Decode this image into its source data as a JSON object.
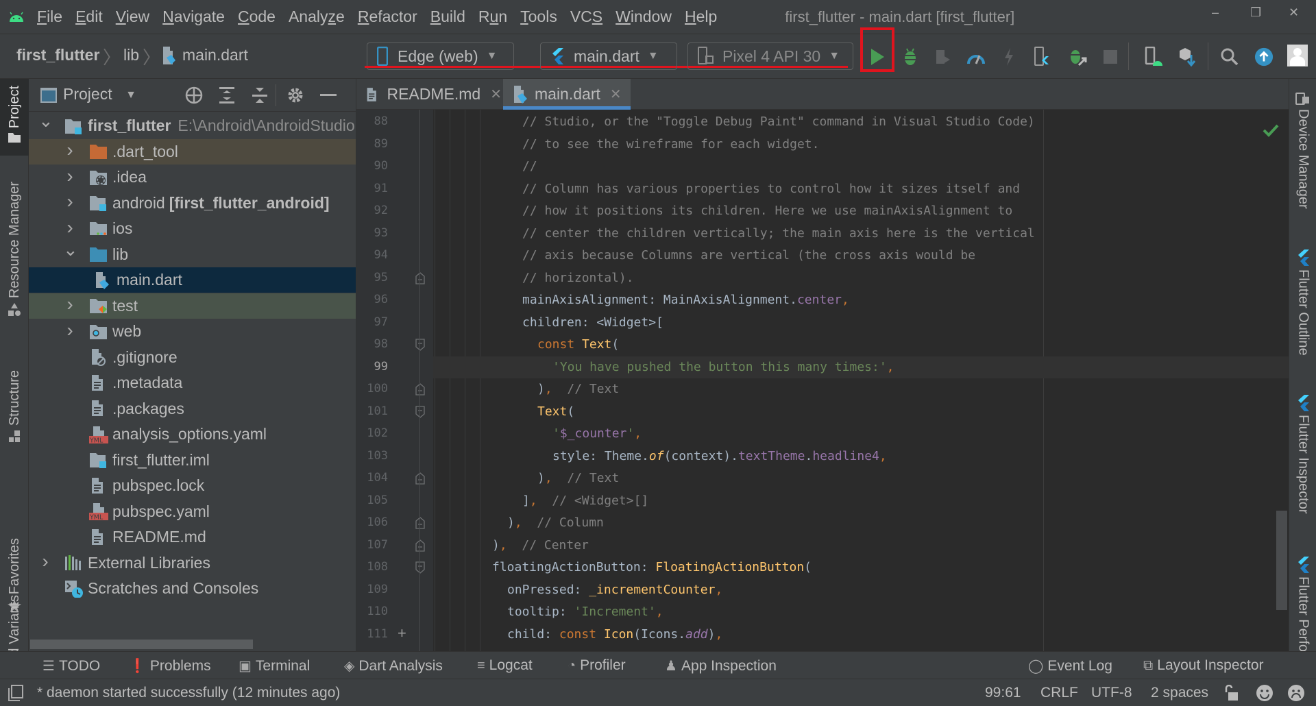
{
  "menubar": {
    "items": [
      {
        "label": "File",
        "mnemonic": 0
      },
      {
        "label": "Edit",
        "mnemonic": 0
      },
      {
        "label": "View",
        "mnemonic": 0
      },
      {
        "label": "Navigate",
        "mnemonic": 0
      },
      {
        "label": "Code",
        "mnemonic": 0
      },
      {
        "label": "Analyze",
        "mnemonic": 5
      },
      {
        "label": "Refactor",
        "mnemonic": 0
      },
      {
        "label": "Build",
        "mnemonic": 0
      },
      {
        "label": "Run",
        "mnemonic": 1
      },
      {
        "label": "Tools",
        "mnemonic": 0
      },
      {
        "label": "VCS",
        "mnemonic": 2
      },
      {
        "label": "Window",
        "mnemonic": 0
      },
      {
        "label": "Help",
        "mnemonic": 0
      }
    ],
    "window_title": "first_flutter - main.dart [first_flutter]",
    "minimize": "–",
    "restore": "❐",
    "close": "✕"
  },
  "navbar": {
    "breadcrumb": [
      "first_flutter",
      "lib",
      "main.dart"
    ],
    "device_combo": "Edge (web)",
    "config_combo": "main.dart",
    "emulator_combo": "Pixel 4 API 30"
  },
  "toolbar_icons": [
    "run-icon",
    "debug-icon",
    "run-with-coverage-icon",
    "profile-icon",
    "hot-reload-icon",
    "flutter-attach-icon",
    "attach-debugger-icon",
    "stop-icon",
    "device-manager-icon",
    "sdk-manager-icon",
    "search-icon",
    "update-icon",
    "account-icon"
  ],
  "left_strip": {
    "tabs": [
      "Project",
      "Resource Manager",
      "Structure",
      "Favorites",
      "Build Variants"
    ]
  },
  "project_panel": {
    "title": "Project",
    "tree": [
      {
        "label": "first_flutter",
        "path": "E:\\Android\\AndroidStudio",
        "bold": true,
        "expanded": true,
        "level": 0,
        "icon": "module-folder"
      },
      {
        "label": ".dart_tool",
        "level": 1,
        "expandable": true,
        "icon": "excluded-folder",
        "state": "ignored"
      },
      {
        "label": ".idea",
        "level": 1,
        "expandable": true,
        "icon": "idea-folder"
      },
      {
        "label": "android",
        "suffix": "[first_flutter_android]",
        "level": 1,
        "expandable": true,
        "icon": "module-folder"
      },
      {
        "label": "ios",
        "level": 1,
        "expandable": true,
        "icon": "ios-folder"
      },
      {
        "label": "lib",
        "level": 1,
        "expandable": true,
        "expanded": true,
        "icon": "source-folder"
      },
      {
        "label": "main.dart",
        "level": 2,
        "icon": "dart-file",
        "state": "selected"
      },
      {
        "label": "test",
        "level": 1,
        "expandable": true,
        "icon": "test-folder",
        "state": "test"
      },
      {
        "label": "web",
        "level": 1,
        "expandable": true,
        "icon": "web-folder"
      },
      {
        "label": ".gitignore",
        "level": 1,
        "icon": "ignore-file"
      },
      {
        "label": ".metadata",
        "level": 1,
        "icon": "text-file"
      },
      {
        "label": ".packages",
        "level": 1,
        "icon": "text-file"
      },
      {
        "label": "analysis_options.yaml",
        "level": 1,
        "icon": "yaml-file"
      },
      {
        "label": "first_flutter.iml",
        "level": 1,
        "icon": "module-file"
      },
      {
        "label": "pubspec.lock",
        "level": 1,
        "icon": "text-file"
      },
      {
        "label": "pubspec.yaml",
        "level": 1,
        "icon": "yaml-file"
      },
      {
        "label": "README.md",
        "level": 1,
        "icon": "text-file"
      },
      {
        "label": "External Libraries",
        "level": 0,
        "expandable": true,
        "icon": "libraries"
      },
      {
        "label": "Scratches and Consoles",
        "level": 0,
        "icon": "scratches"
      }
    ]
  },
  "editor": {
    "tabs": [
      {
        "label": "README.md",
        "active": false
      },
      {
        "label": "main.dart",
        "active": true
      }
    ],
    "current_line": 99,
    "lines": [
      {
        "n": 88,
        "indent": 2,
        "tokens": [
          [
            "c-com",
            "// Studio, or the \"Toggle Debug Paint\" command in Visual Studio Code)"
          ]
        ]
      },
      {
        "n": 89,
        "indent": 2,
        "tokens": [
          [
            "c-com",
            "// to see the wireframe for each widget."
          ]
        ]
      },
      {
        "n": 90,
        "indent": 2,
        "tokens": [
          [
            "c-com",
            "//"
          ]
        ]
      },
      {
        "n": 91,
        "indent": 2,
        "tokens": [
          [
            "c-com",
            "// Column has various properties to control how it sizes itself and"
          ]
        ]
      },
      {
        "n": 92,
        "indent": 2,
        "tokens": [
          [
            "c-com",
            "// how it positions its children. Here we use mainAxisAlignment to"
          ]
        ]
      },
      {
        "n": 93,
        "indent": 2,
        "tokens": [
          [
            "c-com",
            "// center the children vertically; the main axis here is the vertical"
          ]
        ]
      },
      {
        "n": 94,
        "indent": 2,
        "tokens": [
          [
            "c-com",
            "// axis because Columns are vertical (the cross axis would be"
          ]
        ]
      },
      {
        "n": 95,
        "indent": 2,
        "fold": "end",
        "tokens": [
          [
            "c-com",
            "// horizontal)."
          ]
        ]
      },
      {
        "n": 96,
        "indent": 2,
        "tokens": [
          [
            "c-plain",
            "mainAxisAlignment: MainAxisAlignment."
          ],
          [
            "c-fld",
            "center"
          ],
          [
            "c-punc",
            ","
          ]
        ]
      },
      {
        "n": 97,
        "indent": 2,
        "tokens": [
          [
            "c-plain",
            "children: <Widget>["
          ]
        ]
      },
      {
        "n": 98,
        "indent": 3,
        "fold": "start",
        "tokens": [
          [
            "c-kw",
            "const "
          ],
          [
            "c-cls",
            "Text"
          ],
          [
            "c-plain",
            "("
          ]
        ]
      },
      {
        "n": 99,
        "indent": 4,
        "tokens": [
          [
            "c-str",
            "'You have pushed the button this many times:'"
          ],
          [
            "c-punc",
            ","
          ]
        ]
      },
      {
        "n": 100,
        "indent": 3,
        "fold": "end",
        "tokens": [
          [
            "c-plain",
            ")"
          ],
          [
            "c-punc",
            ","
          ],
          [
            "c-com",
            "  // Text"
          ]
        ]
      },
      {
        "n": 101,
        "indent": 3,
        "fold": "start",
        "tokens": [
          [
            "c-cls",
            "Text"
          ],
          [
            "c-plain",
            "("
          ]
        ]
      },
      {
        "n": 102,
        "indent": 4,
        "tokens": [
          [
            "c-str",
            "'"
          ],
          [
            "c-fld",
            "$_counter"
          ],
          [
            "c-str",
            "'"
          ],
          [
            "c-punc",
            ","
          ]
        ]
      },
      {
        "n": 103,
        "indent": 4,
        "tokens": [
          [
            "c-plain",
            "style: Theme."
          ],
          [
            "c-fn",
            "of"
          ],
          [
            "c-plain",
            "(context)."
          ],
          [
            "c-fld",
            "textTheme"
          ],
          [
            "c-plain",
            "."
          ],
          [
            "c-fld",
            "headline4"
          ],
          [
            "c-punc",
            ","
          ]
        ]
      },
      {
        "n": 104,
        "indent": 3,
        "fold": "end",
        "tokens": [
          [
            "c-plain",
            ")"
          ],
          [
            "c-punc",
            ","
          ],
          [
            "c-com",
            "  // Text"
          ]
        ]
      },
      {
        "n": 105,
        "indent": 2,
        "tokens": [
          [
            "c-plain",
            "]"
          ],
          [
            "c-punc",
            ","
          ],
          [
            "c-com",
            "  // <Widget>[]"
          ]
        ]
      },
      {
        "n": 106,
        "indent": 1,
        "fold": "end",
        "tokens": [
          [
            "c-plain",
            ")"
          ],
          [
            "c-punc",
            ","
          ],
          [
            "c-com",
            "  // Column"
          ]
        ]
      },
      {
        "n": 107,
        "indent": 0,
        "fold": "end",
        "tokens": [
          [
            "c-plain",
            ")"
          ],
          [
            "c-punc",
            ","
          ],
          [
            "c-com",
            "  // Center"
          ]
        ]
      },
      {
        "n": 108,
        "indent": 0,
        "fold": "start",
        "tokens": [
          [
            "c-plain",
            "floatingActionButton: "
          ],
          [
            "c-cls",
            "FloatingActionButton"
          ],
          [
            "c-plain",
            "("
          ]
        ]
      },
      {
        "n": 109,
        "indent": 1,
        "tokens": [
          [
            "c-plain",
            "onPressed: "
          ],
          [
            "c-cls",
            "_incrementCounter"
          ],
          [
            "c-punc",
            ","
          ]
        ]
      },
      {
        "n": 110,
        "indent": 1,
        "tokens": [
          [
            "c-plain",
            "tooltip: "
          ],
          [
            "c-str",
            "'Increment'"
          ],
          [
            "c-punc",
            ","
          ]
        ]
      },
      {
        "n": 111,
        "indent": 1,
        "marker": "+",
        "tokens": [
          [
            "c-plain",
            "child: "
          ],
          [
            "c-kw",
            "const "
          ],
          [
            "c-cls",
            "Icon"
          ],
          [
            "c-plain",
            "(Icons."
          ],
          [
            "c-itl",
            "add"
          ],
          [
            "c-plain",
            ")"
          ],
          [
            "c-punc",
            ","
          ]
        ]
      }
    ],
    "inspection_status": "no-problems"
  },
  "right_strip": {
    "tabs": [
      "Device Manager",
      "Flutter Outline",
      "Flutter Inspector",
      "Flutter Performance"
    ]
  },
  "bottom_tools": {
    "left": [
      {
        "label": "TODO",
        "icon": "todo-icon"
      },
      {
        "label": "Problems",
        "icon": "problems-icon"
      },
      {
        "label": "Terminal",
        "icon": "terminal-icon"
      },
      {
        "label": "Dart Analysis",
        "icon": "dart-analysis-icon"
      },
      {
        "label": "Logcat",
        "icon": "logcat-icon"
      },
      {
        "label": "Profiler",
        "icon": "profiler-icon"
      },
      {
        "label": "App Inspection",
        "icon": "app-inspection-icon"
      }
    ],
    "right": [
      {
        "label": "Event Log",
        "icon": "event-log-icon"
      },
      {
        "label": "Layout Inspector",
        "icon": "layout-inspector-icon"
      }
    ]
  },
  "statusbar": {
    "message": "* daemon started successfully (12 minutes ago)",
    "position": "99:61",
    "line_separator": "CRLF",
    "encoding": "UTF-8",
    "indent": "2 spaces"
  },
  "colors": {
    "accent": "#4a88c7",
    "run_green": "#499c54",
    "highlight_red": "#e0141e",
    "selection": "#0d293e"
  }
}
